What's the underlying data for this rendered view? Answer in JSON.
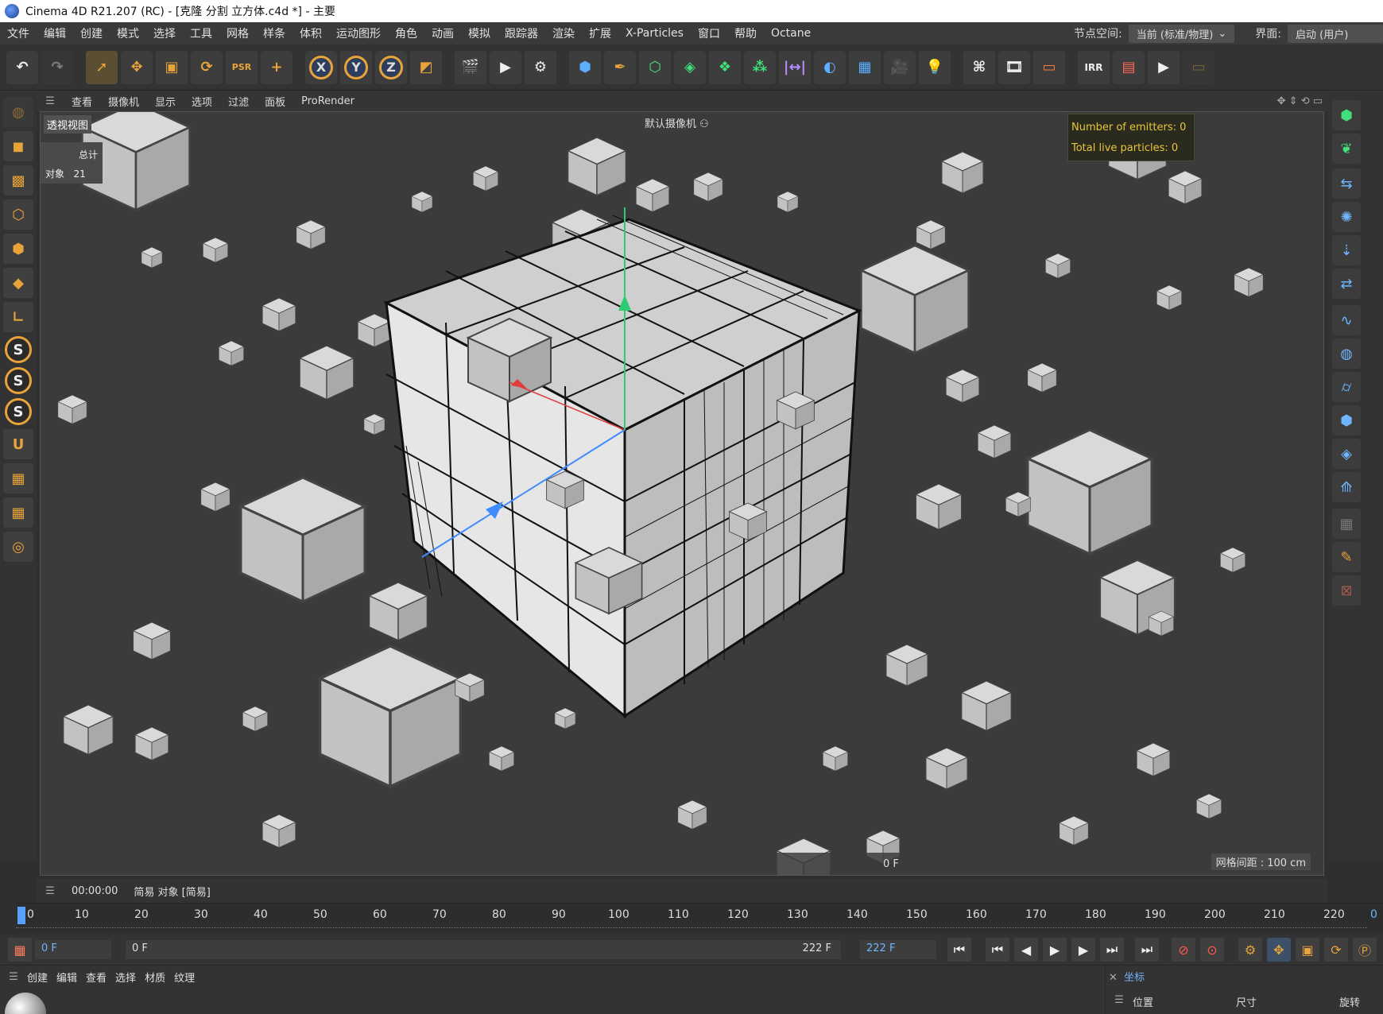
{
  "window": {
    "title": "Cinema 4D R21.207 (RC) - [克隆 分割 立方体.c4d *] - 主要"
  },
  "menu": {
    "items": [
      "文件",
      "编辑",
      "创建",
      "模式",
      "选择",
      "工具",
      "网格",
      "样条",
      "体积",
      "运动图形",
      "角色",
      "动画",
      "模拟",
      "跟踪器",
      "渲染",
      "扩展",
      "X-Particles",
      "窗口",
      "帮助",
      "Octane"
    ],
    "node_space_label": "节点空间:",
    "node_space_value": "当前 (标准/物理)",
    "layout_label": "界面:",
    "layout_value": "启动 (用户)"
  },
  "viewport_menu": {
    "items": [
      "查看",
      "摄像机",
      "显示",
      "选项",
      "过滤",
      "面板",
      "ProRender"
    ]
  },
  "viewport": {
    "view_name": "透视视图",
    "camera": "默认摄像机",
    "stats_total_label": "总计",
    "stats_objects_label": "对象",
    "stats_objects_value": "21",
    "xp_emitters": "Number of emitters: 0",
    "xp_particles": "Total live particles: 0",
    "frame": "0 F",
    "grid_spacing": "网格间距 : 100 cm"
  },
  "timeline": {
    "time": "00:00:00",
    "mode": "简易 对象 [简易]",
    "ticks": [
      "0",
      "10",
      "20",
      "30",
      "40",
      "50",
      "60",
      "70",
      "80",
      "90",
      "100",
      "110",
      "120",
      "130",
      "140",
      "150",
      "160",
      "170",
      "180",
      "190",
      "200",
      "210",
      "220"
    ],
    "right_value": "0"
  },
  "transport": {
    "current_frame": "0 F",
    "range_start": "0 F",
    "range_end_left": "222 F",
    "range_end": "222 F"
  },
  "material_manager": {
    "items": [
      "创建",
      "编辑",
      "查看",
      "选择",
      "材质",
      "纹理"
    ]
  },
  "coordinates": {
    "tab": "坐标",
    "position": "位置",
    "size": "尺寸",
    "rotation": "旋转"
  },
  "colors": {
    "accent": "#e8a33a",
    "axis_green": "#2ecc71",
    "axis_blue": "#3f8cff",
    "axis_red": "#e03c3c"
  }
}
